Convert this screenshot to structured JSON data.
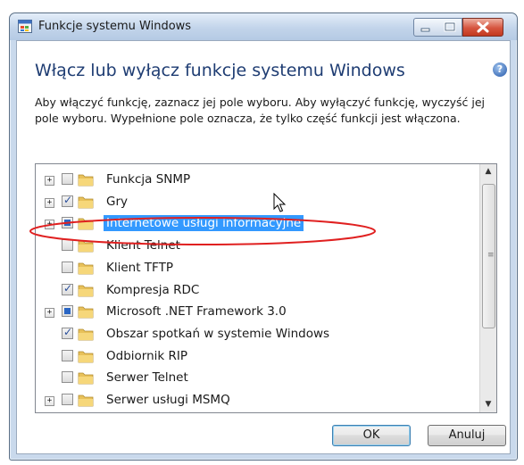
{
  "window": {
    "title": "Funkcje systemu Windows",
    "controls": [
      "minimize",
      "maximize",
      "close"
    ]
  },
  "dialog": {
    "heading": "Włącz lub wyłącz funkcje systemu Windows",
    "description": "Aby włączyć funkcję, zaznacz jej pole wyboru. Aby wyłączyć funkcję, wyczyść jej pole wyboru. Wypełnione pole oznacza, że tylko część funkcji jest włączona."
  },
  "features": [
    {
      "label": "Funkcja SNMP",
      "expandable": true,
      "state": "unchecked"
    },
    {
      "label": "Gry",
      "expandable": true,
      "state": "checked"
    },
    {
      "label": "Internetowe usługi informacyjne",
      "expandable": true,
      "state": "partial",
      "selected": true
    },
    {
      "label": "Klient Telnet",
      "expandable": false,
      "state": "unchecked"
    },
    {
      "label": "Klient TFTP",
      "expandable": false,
      "state": "unchecked"
    },
    {
      "label": "Kompresja RDC",
      "expandable": false,
      "state": "checked"
    },
    {
      "label": "Microsoft .NET Framework 3.0",
      "expandable": true,
      "state": "partial"
    },
    {
      "label": "Obszar spotkań w systemie Windows",
      "expandable": false,
      "state": "checked"
    },
    {
      "label": "Odbiornik RIP",
      "expandable": false,
      "state": "unchecked"
    },
    {
      "label": "Serwer Telnet",
      "expandable": false,
      "state": "unchecked"
    },
    {
      "label": "Serwer usługi MSMQ",
      "expandable": true,
      "state": "unchecked"
    }
  ],
  "buttons": {
    "ok": "OK",
    "cancel": "Anuluj"
  },
  "colors": {
    "selection": "#3399ff",
    "heading": "#1f3d73",
    "annotation": "#e02020"
  }
}
